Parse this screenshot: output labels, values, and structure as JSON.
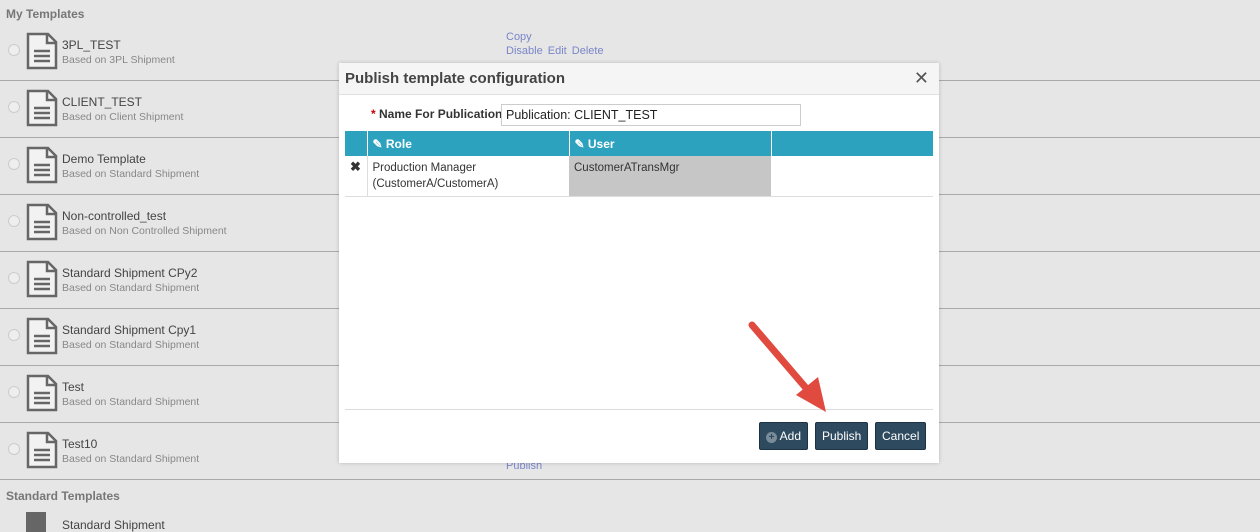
{
  "my_templates_label": "My Templates",
  "standard_templates_label": "Standard Templates",
  "templates": [
    {
      "name": "3PL_TEST",
      "sub": "Based on 3PL Shipment"
    },
    {
      "name": "CLIENT_TEST",
      "sub": "Based on Client Shipment"
    },
    {
      "name": "Demo Template",
      "sub": "Based on Standard Shipment"
    },
    {
      "name": "Non-controlled_test",
      "sub": "Based on Non Controlled Shipment"
    },
    {
      "name": "Standard Shipment CPy2",
      "sub": "Based on Standard Shipment"
    },
    {
      "name": "Standard Shipment Cpy1",
      "sub": "Based on Standard Shipment"
    },
    {
      "name": "Test",
      "sub": "Based on Standard Shipment"
    },
    {
      "name": "Test10",
      "sub": "Based on Standard Shipment"
    }
  ],
  "row_actions": {
    "copy": "Copy",
    "disable": "Disable",
    "edit": "Edit",
    "delete": "Delete",
    "publish": "Publish"
  },
  "standard_template": "Standard Shipment",
  "modal": {
    "title": "Publish template configuration",
    "name_label": "Name For Publication:",
    "required": "*",
    "name_value": "Publication: CLIENT_TEST",
    "columns": [
      "Role",
      "User"
    ],
    "rows": [
      {
        "role_line1": "Production Manager",
        "role_line2": "(CustomerA/CustomerA)",
        "user": "CustomerATransMgr"
      }
    ],
    "add": "Add",
    "publish": "Publish",
    "cancel": "Cancel"
  }
}
